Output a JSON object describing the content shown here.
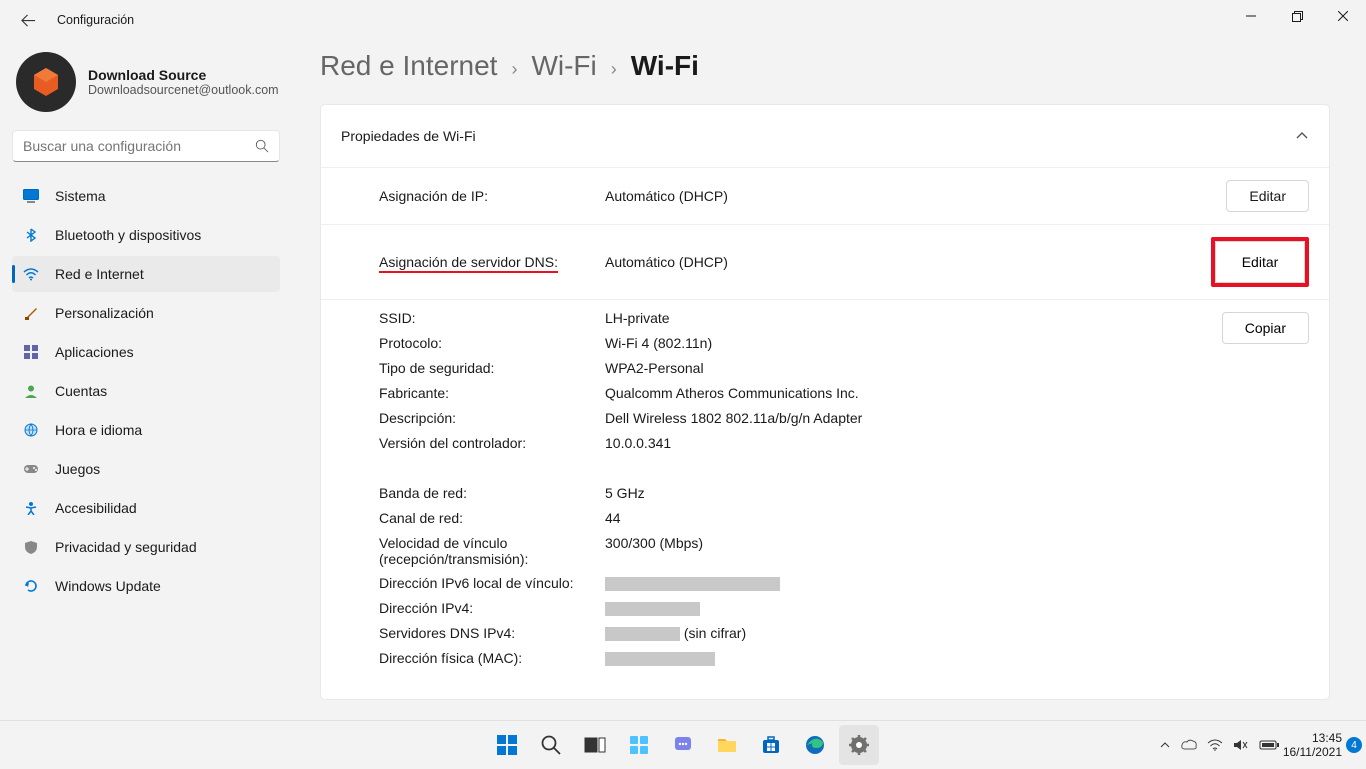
{
  "titlebar": {
    "title": "Configuración"
  },
  "profile": {
    "name": "Download Source",
    "email": "Downloadsourcenet@outlook.com"
  },
  "search": {
    "placeholder": "Buscar una configuración"
  },
  "nav": {
    "system": "Sistema",
    "bluetooth": "Bluetooth y dispositivos",
    "network": "Red e Internet",
    "personalization": "Personalización",
    "apps": "Aplicaciones",
    "accounts": "Cuentas",
    "time": "Hora e idioma",
    "gaming": "Juegos",
    "accessibility": "Accesibilidad",
    "privacy": "Privacidad y seguridad",
    "update": "Windows Update"
  },
  "breadcrumb": {
    "a": "Red e Internet",
    "b": "Wi-Fi",
    "c": "Wi-Fi"
  },
  "card": {
    "title": "Propiedades de Wi-Fi"
  },
  "ip_row": {
    "label": "Asignación de IP:",
    "value": "Automático (DHCP)",
    "button": "Editar"
  },
  "dns_row": {
    "label": "Asignación de servidor DNS:",
    "value": "Automático (DHCP)",
    "button": "Editar"
  },
  "copy": "Copiar",
  "details": {
    "ssid_l": "SSID:",
    "ssid_v": "LH-private",
    "proto_l": "Protocolo:",
    "proto_v": "Wi-Fi 4 (802.11n)",
    "sec_l": "Tipo de seguridad:",
    "sec_v": "WPA2-Personal",
    "manu_l": "Fabricante:",
    "manu_v": "Qualcomm Atheros Communications Inc.",
    "desc_l": "Descripción:",
    "desc_v": "Dell Wireless 1802 802.11a/b/g/n Adapter",
    "drv_l": "Versión del controlador:",
    "drv_v": "10.0.0.341",
    "band_l": "Banda de red:",
    "band_v": "5 GHz",
    "chan_l": "Canal de red:",
    "chan_v": "44",
    "speed_l": "Velocidad de vínculo (recepción/transmisión):",
    "speed_v": "300/300 (Mbps)",
    "ipv6_l": "Dirección IPv6 local de vínculo:",
    "ipv4_l": "Dirección IPv4:",
    "dns4_l": "Servidores DNS IPv4:",
    "dns4_suffix": "(sin cifrar)",
    "mac_l": "Dirección física (MAC):"
  },
  "tray": {
    "time": "13:45",
    "date": "16/11/2021",
    "badge": "4"
  }
}
